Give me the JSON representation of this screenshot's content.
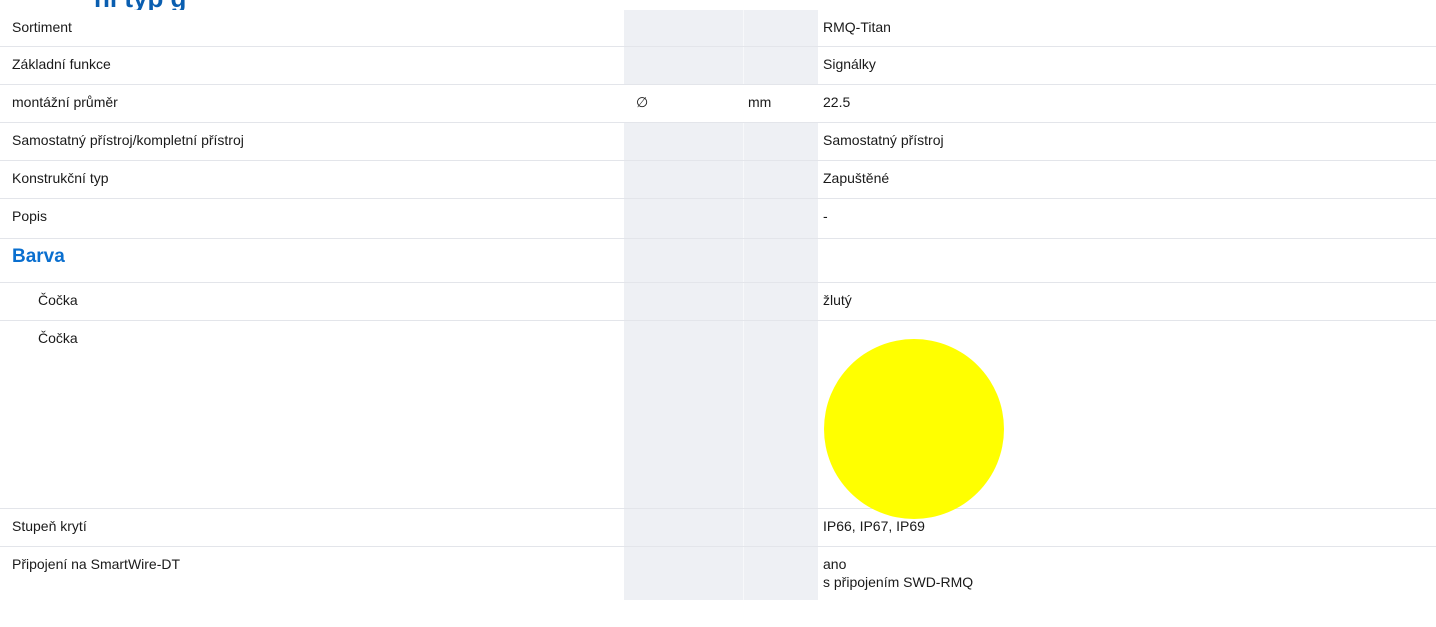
{
  "page": {
    "title_partial": "ní typ     g"
  },
  "colors": {
    "lens_swatch": "#ffff00",
    "section_heading": "#0a6fcf",
    "shaded_column": "#eef0f4"
  },
  "rows": {
    "sortiment": {
      "label": "Sortiment",
      "value": "RMQ-Titan"
    },
    "zakladni_funkce": {
      "label": "Základní funkce",
      "value": "Signálky"
    },
    "montazni_prumer": {
      "label": "montážní průměr",
      "symbol": "∅",
      "unit": "mm",
      "value": "22.5"
    },
    "samostatny": {
      "label": "Samostatný přístroj/kompletní přístroj",
      "value": "Samostatný přístroj"
    },
    "konstrukcni_typ": {
      "label": "Konstrukční typ",
      "value": "Zapuštěné"
    },
    "popis": {
      "label": "Popis",
      "value": "-"
    },
    "barva": {
      "label": "Barva"
    },
    "cocka_text": {
      "label": "Čočka",
      "value": "žlutý"
    },
    "cocka_swatch": {
      "label": "Čočka",
      "swatch_icon": "yellow-circle"
    },
    "stupen_kryti": {
      "label": "Stupeň krytí",
      "value": "IP66, IP67, IP69"
    },
    "smartwire": {
      "label": "Připojení na SmartWire-DT",
      "value_line1": "ano",
      "value_line2": "s připojením SWD-RMQ"
    }
  }
}
